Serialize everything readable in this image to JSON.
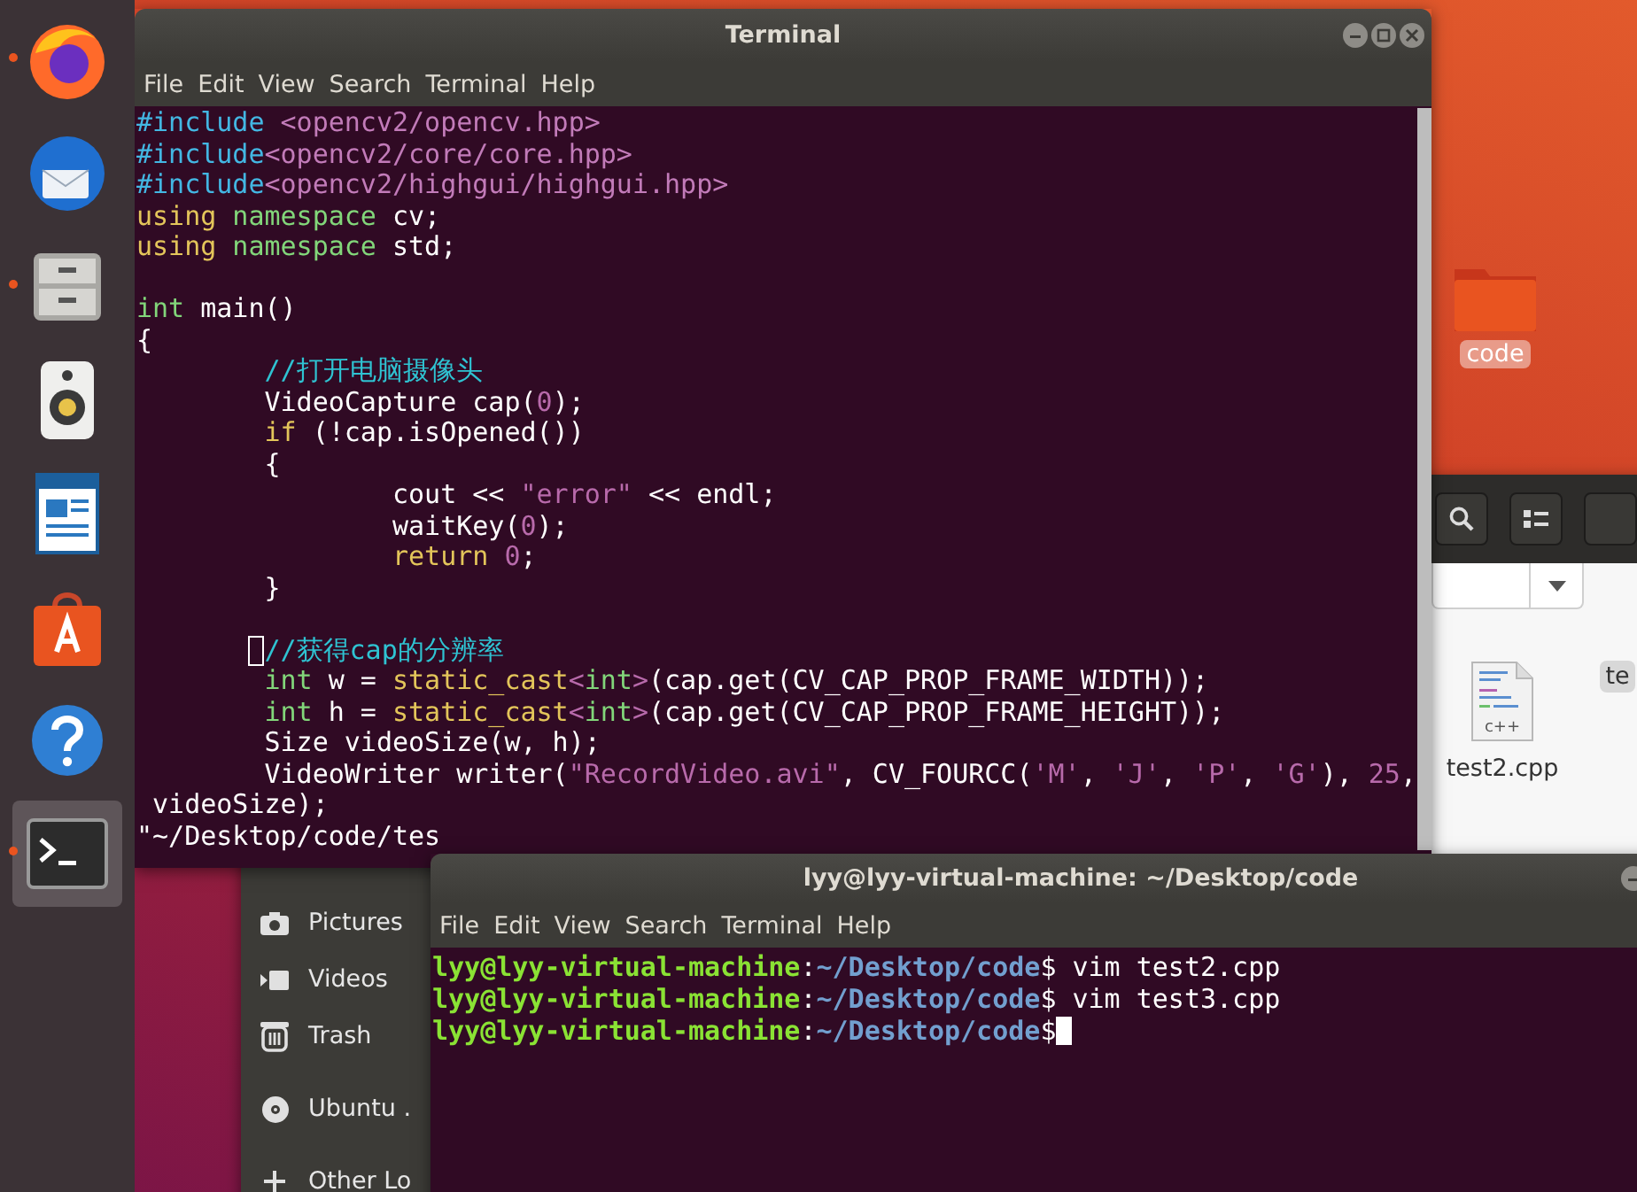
{
  "dock": {
    "items": [
      {
        "kind": "browser",
        "running": true,
        "selected": false
      },
      {
        "kind": "mail",
        "running": false,
        "selected": false
      },
      {
        "kind": "files",
        "running": true,
        "selected": false
      },
      {
        "kind": "music",
        "running": false,
        "selected": false
      },
      {
        "kind": "document",
        "running": false,
        "selected": false
      },
      {
        "kind": "store",
        "running": false,
        "selected": false
      },
      {
        "kind": "help",
        "running": false,
        "selected": false
      },
      {
        "kind": "terminal",
        "running": true,
        "selected": true
      }
    ]
  },
  "desktop_icons": [
    {
      "label": "code",
      "selected": true
    }
  ],
  "file_manager": {
    "toolbar_buttons": [
      {
        "kind": "search"
      },
      {
        "kind": "view_list"
      },
      {
        "kind": "blank"
      }
    ],
    "sidebar": {
      "items": [
        {
          "kind": "pictures",
          "label": "Pictures"
        },
        {
          "kind": "videos",
          "label": "Videos"
        },
        {
          "kind": "trash",
          "label": "Trash"
        },
        {
          "kind": "disc",
          "label": "Ubuntu ."
        },
        {
          "kind": "other",
          "label": "Other Lo"
        }
      ]
    },
    "files": [
      {
        "name": "test2.cpp",
        "type_label": "c++",
        "selected": false
      },
      {
        "name": "te",
        "selected": true
      }
    ]
  },
  "editor_terminal": {
    "title": "Terminal",
    "menu": [
      "File",
      "Edit",
      "View",
      "Search",
      "Terminal",
      "Help"
    ],
    "lines": [
      {
        "kind": "code",
        "tokens": [
          {
            "text": "#include ",
            "kind": "preproc"
          },
          {
            "text": "<opencv2/opencv.hpp>",
            "kind": "include_path"
          }
        ]
      },
      {
        "kind": "code",
        "tokens": [
          {
            "text": "#include",
            "kind": "preproc"
          },
          {
            "text": "<opencv2/core/core.hpp>",
            "kind": "include_path"
          }
        ]
      },
      {
        "kind": "code",
        "tokens": [
          {
            "text": "#include",
            "kind": "preproc"
          },
          {
            "text": "<opencv2/highgui/highgui.hpp>",
            "kind": "include_path"
          }
        ]
      },
      {
        "kind": "code",
        "tokens": [
          {
            "text": "using",
            "kind": "keyword"
          },
          {
            "text": " namespace",
            "kind": "type"
          },
          {
            "text": " cv;",
            "kind": "plain"
          }
        ]
      },
      {
        "kind": "code",
        "tokens": [
          {
            "text": "using",
            "kind": "keyword"
          },
          {
            "text": " namespace",
            "kind": "type"
          },
          {
            "text": " std;",
            "kind": "plain"
          }
        ]
      },
      {
        "kind": "blank"
      },
      {
        "kind": "code",
        "tokens": [
          {
            "text": "int",
            "kind": "type"
          },
          {
            "text": " main()",
            "kind": "plain"
          }
        ]
      },
      {
        "kind": "code",
        "tokens": [
          {
            "text": "{",
            "kind": "plain"
          }
        ]
      },
      {
        "kind": "code",
        "tokens": [
          {
            "text": "        //打开电脑摄像头",
            "kind": "comment"
          }
        ]
      },
      {
        "kind": "code",
        "tokens": [
          {
            "text": "        VideoCapture cap(",
            "kind": "plain"
          },
          {
            "text": "0",
            "kind": "literal"
          },
          {
            "text": ");",
            "kind": "plain"
          }
        ]
      },
      {
        "kind": "code",
        "tokens": [
          {
            "text": "        if",
            "kind": "keyword"
          },
          {
            "text": " (!cap.isOpened())",
            "kind": "plain"
          }
        ]
      },
      {
        "kind": "code",
        "tokens": [
          {
            "text": "        {",
            "kind": "plain"
          }
        ]
      },
      {
        "kind": "code",
        "tokens": [
          {
            "text": "                cout << ",
            "kind": "plain"
          },
          {
            "text": "\"error\"",
            "kind": "literal"
          },
          {
            "text": " << endl;",
            "kind": "plain"
          }
        ]
      },
      {
        "kind": "code",
        "tokens": [
          {
            "text": "                waitKey(",
            "kind": "plain"
          },
          {
            "text": "0",
            "kind": "literal"
          },
          {
            "text": ");",
            "kind": "plain"
          }
        ]
      },
      {
        "kind": "code",
        "tokens": [
          {
            "text": "                return",
            "kind": "keyword"
          },
          {
            "text": " 0",
            "kind": "literal"
          },
          {
            "text": ";",
            "kind": "plain"
          }
        ]
      },
      {
        "kind": "code",
        "tokens": [
          {
            "text": "        }",
            "kind": "plain"
          }
        ]
      },
      {
        "kind": "blank"
      },
      {
        "kind": "code",
        "tokens": [
          {
            "kind": "cursor"
          },
          {
            "text": "//获得cap的分辨率",
            "kind": "comment"
          }
        ]
      },
      {
        "kind": "code",
        "tokens": [
          {
            "text": "        int",
            "kind": "type"
          },
          {
            "text": " w = ",
            "kind": "plain"
          },
          {
            "text": "static_cast",
            "kind": "keyword"
          },
          {
            "text": "<",
            "kind": "literal"
          },
          {
            "text": "int",
            "kind": "type"
          },
          {
            "text": ">",
            "kind": "literal"
          },
          {
            "text": "(cap.get(CV_CAP_PROP_FRAME_WIDTH));",
            "kind": "plain"
          }
        ]
      },
      {
        "kind": "code",
        "tokens": [
          {
            "text": "        int",
            "kind": "type"
          },
          {
            "text": " h = ",
            "kind": "plain"
          },
          {
            "text": "static_cast",
            "kind": "keyword"
          },
          {
            "text": "<",
            "kind": "literal"
          },
          {
            "text": "int",
            "kind": "type"
          },
          {
            "text": ">",
            "kind": "literal"
          },
          {
            "text": "(cap.get(CV_CAP_PROP_FRAME_HEIGHT));",
            "kind": "plain"
          }
        ]
      },
      {
        "kind": "code",
        "tokens": [
          {
            "text": "        Size videoSize(w, h);",
            "kind": "plain"
          }
        ]
      },
      {
        "kind": "code",
        "tokens": [
          {
            "text": "        VideoWriter writer(",
            "kind": "plain"
          },
          {
            "text": "\"RecordVideo.avi\"",
            "kind": "literal"
          },
          {
            "text": ", CV_FOURCC(",
            "kind": "plain"
          },
          {
            "text": "'M'",
            "kind": "literal"
          },
          {
            "text": ", ",
            "kind": "plain"
          },
          {
            "text": "'J'",
            "kind": "literal"
          },
          {
            "text": ", ",
            "kind": "plain"
          },
          {
            "text": "'P'",
            "kind": "literal"
          },
          {
            "text": ", ",
            "kind": "plain"
          },
          {
            "text": "'G'",
            "kind": "literal"
          },
          {
            "text": "), ",
            "kind": "plain"
          },
          {
            "text": "25",
            "kind": "literal"
          },
          {
            "text": ",",
            "kind": "plain"
          }
        ]
      },
      {
        "kind": "code",
        "tokens": [
          {
            "text": " videoSize);",
            "kind": "plain"
          }
        ]
      },
      {
        "kind": "code",
        "tokens": [
          {
            "text": "\"~/Desktop/code/tes",
            "kind": "plain"
          }
        ]
      }
    ]
  },
  "shell_terminal": {
    "title": "lyy@lyy-virtual-machine: ~/Desktop/code",
    "menu": [
      "File",
      "Edit",
      "View",
      "Search",
      "Terminal",
      "Help"
    ],
    "lines": [
      {
        "kind": "code",
        "tokens": [
          {
            "text": "lyy@lyy-virtual-machine",
            "kind": "user"
          },
          {
            "text": ":",
            "kind": "plain"
          },
          {
            "text": "~/Desktop/code",
            "kind": "path"
          },
          {
            "text": "$ vim test2.cpp",
            "kind": "plain"
          }
        ]
      },
      {
        "kind": "code",
        "tokens": [
          {
            "text": "lyy@lyy-virtual-machine",
            "kind": "user"
          },
          {
            "text": ":",
            "kind": "plain"
          },
          {
            "text": "~/Desktop/code",
            "kind": "path"
          },
          {
            "text": "$ vim test3.cpp",
            "kind": "plain"
          }
        ]
      },
      {
        "kind": "code",
        "tokens": [
          {
            "text": "lyy@lyy-virtual-machine",
            "kind": "user"
          },
          {
            "text": ":",
            "kind": "plain"
          },
          {
            "text": "~/Desktop/code",
            "kind": "path"
          },
          {
            "text": "$",
            "kind": "plain"
          },
          {
            "kind": "block_cursor"
          }
        ]
      }
    ]
  }
}
